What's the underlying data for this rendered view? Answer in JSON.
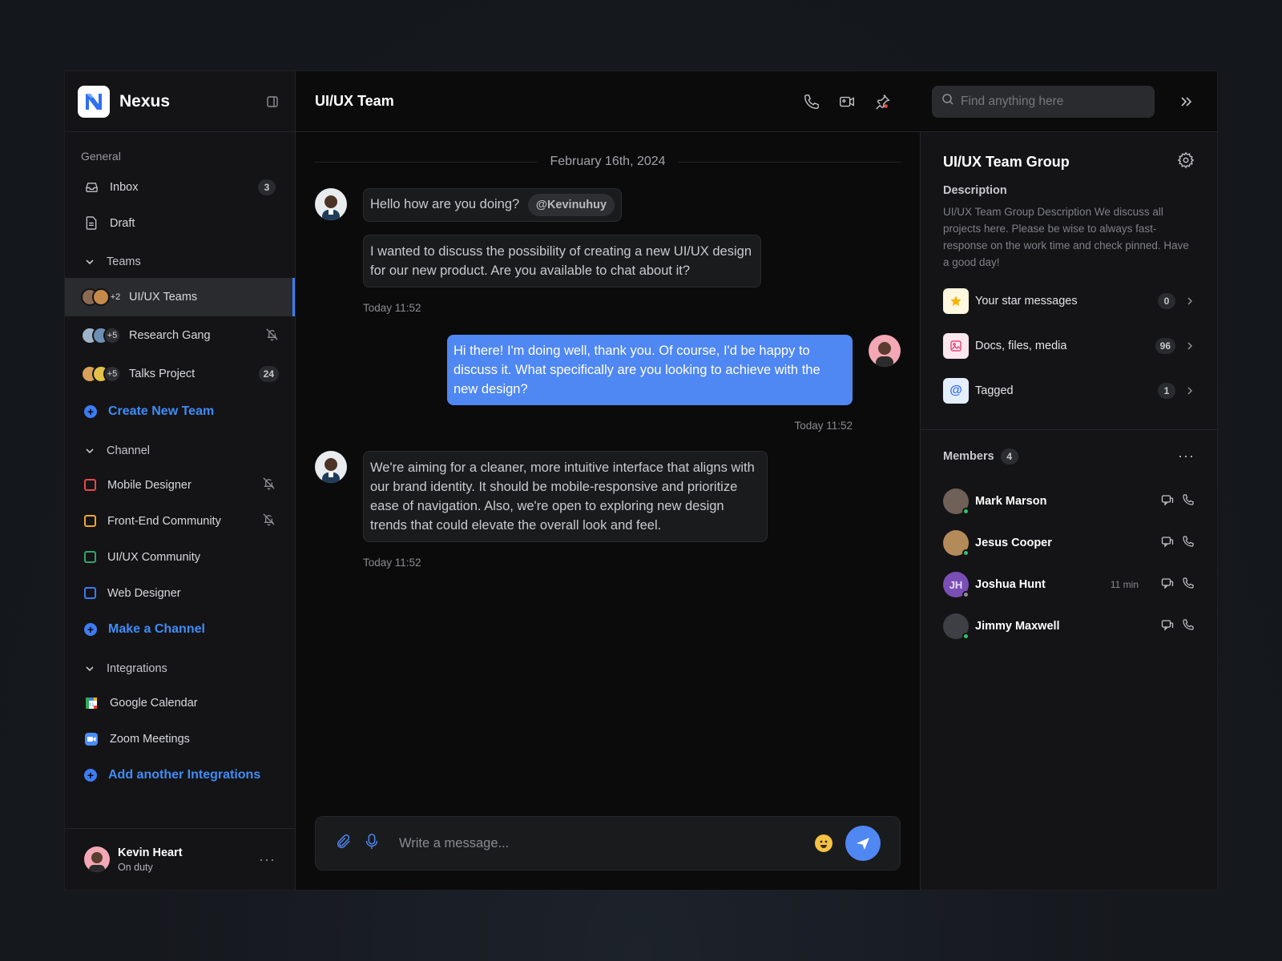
{
  "app": {
    "name": "Nexus"
  },
  "sidebar": {
    "general_label": "General",
    "general_items": [
      {
        "label": "Inbox",
        "icon": "inbox-icon",
        "badge": "3"
      },
      {
        "label": "Draft",
        "icon": "draft-icon"
      }
    ],
    "teams_label": "Teams",
    "teams": [
      {
        "label": "UI/UX Teams",
        "extra": "+2",
        "active": true
      },
      {
        "label": "Research Gang",
        "extra": "+5",
        "muted": true
      },
      {
        "label": "Talks Project",
        "extra": "+5",
        "badge": "24"
      }
    ],
    "create_team": "Create New Team",
    "channel_label": "Channel",
    "channels": [
      {
        "label": "Mobile Designer",
        "color": "#e5484d",
        "muted": true
      },
      {
        "label": "Front-End Community",
        "color": "#f5a524",
        "muted": true
      },
      {
        "label": "UI/UX Community",
        "color": "#30a46c"
      },
      {
        "label": "Web Designer",
        "color": "#3b7bf0"
      }
    ],
    "make_channel": "Make a Channel",
    "integrations_label": "Integrations",
    "integrations": [
      {
        "label": "Google Calendar",
        "icon": "google-calendar-icon"
      },
      {
        "label": "Zoom Meetings",
        "icon": "zoom-icon"
      }
    ],
    "add_integration": "Add another Integrations",
    "user": {
      "name": "Kevin Heart",
      "status": "On duty"
    }
  },
  "header": {
    "title": "UI/UX Team",
    "search_placeholder": "Find anything here"
  },
  "chat": {
    "date": "February 16th, 2024",
    "messages": [
      {
        "text": "Hello how are you doing?",
        "mention": "@Kevinuhuy"
      },
      {
        "text": "I wanted to discuss the possibility of creating a new UI/UX design for our new product. Are you available to chat about it?"
      }
    ],
    "time1": "Today 11:52",
    "reply": "Hi there! I'm doing well, thank you. Of course, I'd be happy to discuss it. What specifically are you looking to achieve with the new design?",
    "time2": "Today 11:52",
    "message3": "We're aiming for a cleaner, more intuitive interface that aligns with our brand identity. It should be mobile-responsive and prioritize ease of navigation. Also, we're open to exploring new design trends that could elevate the overall look and feel.",
    "time3": "Today 11:52",
    "composer_placeholder": "Write a message..."
  },
  "panel": {
    "title": "UI/UX Team Group",
    "description_label": "Description",
    "description": "UI/UX Team Group Description We discuss all projects here. Please be wise to always fast-response on the work time and check pinned. Have a good day!",
    "resources": [
      {
        "label": "Your star messages",
        "count": "0",
        "icon": "star-icon"
      },
      {
        "label": "Docs, files, media",
        "count": "96",
        "icon": "image-icon"
      },
      {
        "label": "Tagged",
        "count": "1",
        "icon": "at-icon"
      }
    ],
    "members_label": "Members",
    "members_count": "4",
    "members": [
      {
        "name": "Mark Marson",
        "status": "online"
      },
      {
        "name": "Jesus Cooper",
        "status": "online"
      },
      {
        "name": "Joshua Hunt",
        "initials": "JH",
        "time": "11 min",
        "status": "away"
      },
      {
        "name": "Jimmy Maxwell",
        "status": "online"
      }
    ]
  },
  "colors": {
    "accent": "#4f87f3",
    "online": "#30c46c"
  }
}
